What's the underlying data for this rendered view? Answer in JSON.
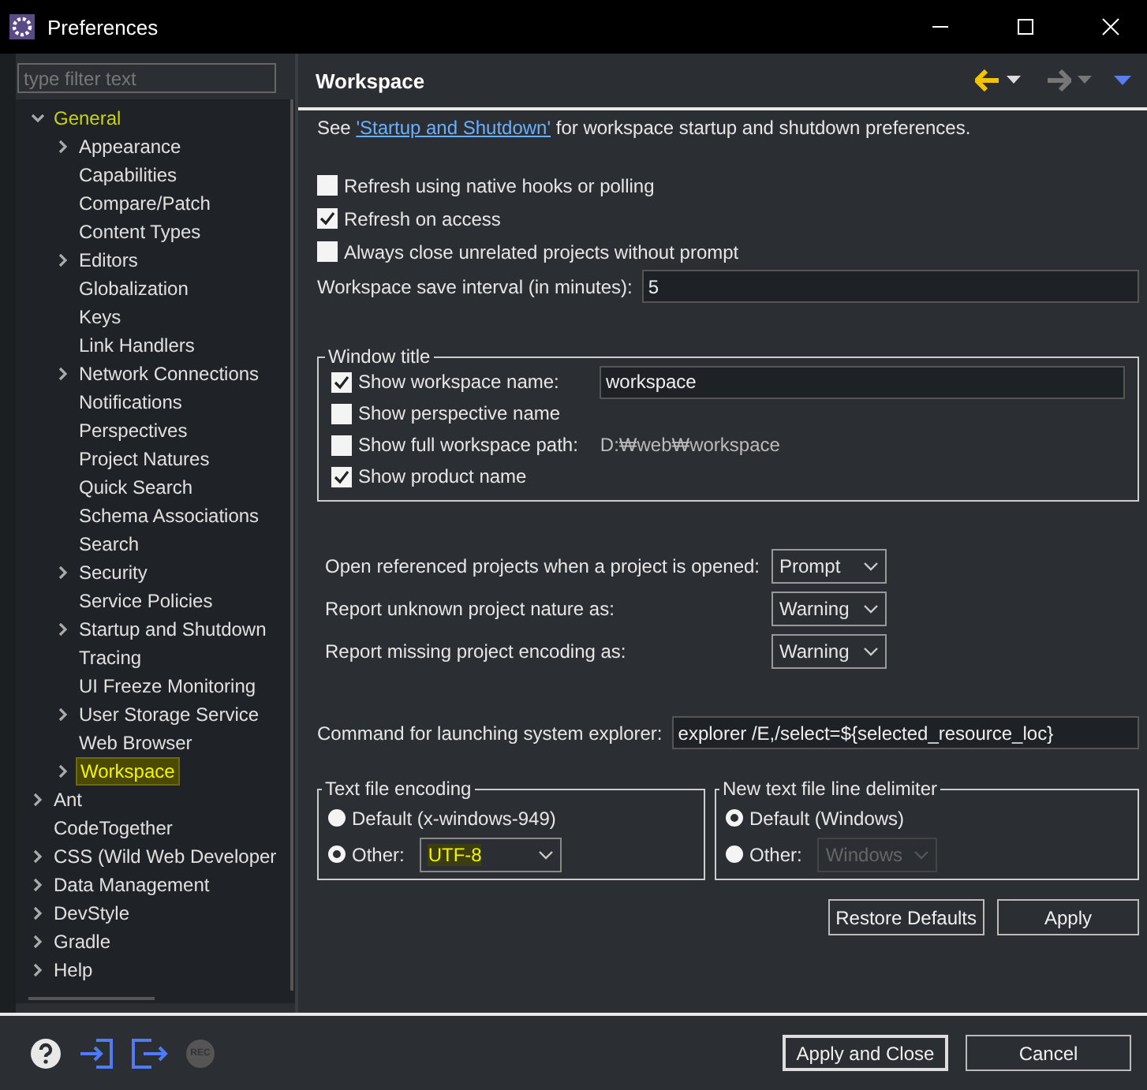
{
  "window": {
    "title": "Preferences"
  },
  "filter": {
    "placeholder": "type filter text"
  },
  "tree": [
    {
      "label": "General",
      "kind": "folder",
      "expanded": true,
      "selected": false,
      "highlighted": true,
      "children": [
        {
          "label": "Appearance",
          "kind": "folder",
          "expanded": false,
          "selected": false,
          "highlighted": false
        },
        {
          "label": "Capabilities",
          "kind": "leaf",
          "selected": false,
          "highlighted": false
        },
        {
          "label": "Compare/Patch",
          "kind": "leaf",
          "selected": false,
          "highlighted": false
        },
        {
          "label": "Content Types",
          "kind": "leaf",
          "selected": false,
          "highlighted": false
        },
        {
          "label": "Editors",
          "kind": "folder",
          "expanded": false,
          "selected": false,
          "highlighted": false
        },
        {
          "label": "Globalization",
          "kind": "leaf",
          "selected": false,
          "highlighted": false
        },
        {
          "label": "Keys",
          "kind": "leaf",
          "selected": false,
          "highlighted": false
        },
        {
          "label": "Link Handlers",
          "kind": "leaf",
          "selected": false,
          "highlighted": false
        },
        {
          "label": "Network Connections",
          "kind": "folder",
          "expanded": false,
          "selected": false,
          "highlighted": false
        },
        {
          "label": "Notifications",
          "kind": "leaf",
          "selected": false,
          "highlighted": false
        },
        {
          "label": "Perspectives",
          "kind": "leaf",
          "selected": false,
          "highlighted": false
        },
        {
          "label": "Project Natures",
          "kind": "leaf",
          "selected": false,
          "highlighted": false
        },
        {
          "label": "Quick Search",
          "kind": "leaf",
          "selected": false,
          "highlighted": false
        },
        {
          "label": "Schema Associations",
          "kind": "leaf",
          "selected": false,
          "highlighted": false
        },
        {
          "label": "Search",
          "kind": "leaf",
          "selected": false,
          "highlighted": false
        },
        {
          "label": "Security",
          "kind": "folder",
          "expanded": false,
          "selected": false,
          "highlighted": false
        },
        {
          "label": "Service Policies",
          "kind": "leaf",
          "selected": false,
          "highlighted": false
        },
        {
          "label": "Startup and Shutdown",
          "kind": "folder",
          "expanded": false,
          "selected": false,
          "highlighted": false
        },
        {
          "label": "Tracing",
          "kind": "leaf",
          "selected": false,
          "highlighted": false
        },
        {
          "label": "UI Freeze Monitoring",
          "kind": "leaf",
          "selected": false,
          "highlighted": false
        },
        {
          "label": "User Storage Service",
          "kind": "folder",
          "expanded": false,
          "selected": false,
          "highlighted": false
        },
        {
          "label": "Web Browser",
          "kind": "leaf",
          "selected": false,
          "highlighted": false
        },
        {
          "label": "Workspace",
          "kind": "folder",
          "expanded": false,
          "selected": true,
          "highlighted": false
        }
      ]
    },
    {
      "label": "Ant",
      "kind": "folder",
      "expanded": false,
      "selected": false,
      "highlighted": false
    },
    {
      "label": "CodeTogether",
      "kind": "leaf",
      "selected": false,
      "highlighted": false
    },
    {
      "label": "CSS (Wild Web Developer",
      "kind": "folder",
      "expanded": false,
      "selected": false,
      "highlighted": false
    },
    {
      "label": "Data Management",
      "kind": "folder",
      "expanded": false,
      "selected": false,
      "highlighted": false
    },
    {
      "label": "DevStyle",
      "kind": "folder",
      "expanded": false,
      "selected": false,
      "highlighted": false
    },
    {
      "label": "Gradle",
      "kind": "folder",
      "expanded": false,
      "selected": false,
      "highlighted": false
    },
    {
      "label": "Help",
      "kind": "folder",
      "expanded": false,
      "selected": false,
      "highlighted": false
    }
  ],
  "page": {
    "title": "Workspace",
    "intro": {
      "before": "See",
      "link": "'Startup and Shutdown'",
      "after": "for workspace startup and shutdown preferences."
    },
    "options": [
      {
        "label": "Refresh using native hooks or polling",
        "checked": false
      },
      {
        "label": "Refresh on access",
        "checked": true
      },
      {
        "label": "Always close unrelated projects without prompt",
        "checked": false
      }
    ],
    "save_interval": {
      "label": "Workspace save interval (in minutes):",
      "value": "5"
    },
    "window_title": {
      "legend": "Window title",
      "items": [
        {
          "kind": "field",
          "label": "Show workspace name:",
          "checked": true,
          "value": "workspace"
        },
        {
          "kind": "plain",
          "label": "Show perspective name",
          "checked": false
        },
        {
          "kind": "path",
          "label": "Show full workspace path:",
          "checked": false,
          "value": "D:₩web₩workspace"
        },
        {
          "kind": "plain",
          "label": "Show product name",
          "checked": true
        }
      ]
    },
    "selects": [
      {
        "label": "Open referenced projects when a project is opened:",
        "value": "Prompt"
      },
      {
        "label": "Report unknown project nature as:",
        "value": "Warning"
      },
      {
        "label": "Report missing project encoding as:",
        "value": "Warning"
      }
    ],
    "explorer": {
      "label": "Command for launching system explorer:",
      "value": "explorer /E,/select=${selected_resource_loc}"
    },
    "encoding": {
      "legend": "Text file encoding",
      "default": {
        "label": "Default (x-windows-949)",
        "selected": false
      },
      "other": {
        "label": "Other:",
        "selected": true,
        "value": "UTF-8",
        "disabled": false
      }
    },
    "delimiter": {
      "legend": "New text file line delimiter",
      "default": {
        "label": "Default (Windows)",
        "selected": true
      },
      "other": {
        "label": "Other:",
        "selected": false,
        "value": "Windows",
        "disabled": true
      }
    },
    "buttons": [
      "Restore Defaults",
      "Apply"
    ]
  },
  "footer": {
    "rec": "REC",
    "buttons": [
      "Apply and Close",
      "Cancel"
    ]
  }
}
